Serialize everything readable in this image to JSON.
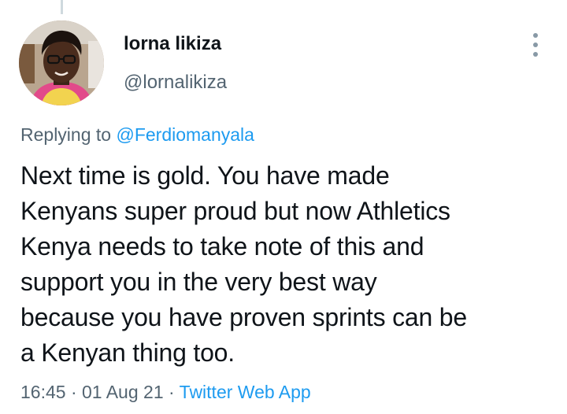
{
  "author": {
    "display_name": "lorna likiza",
    "handle": "@lornalikiza"
  },
  "reply": {
    "prefix": "Replying to",
    "mention": "@Ferdiomanyala"
  },
  "tweet": {
    "text": "Next time is gold. You have made\nKenyans super proud but now Athletics\nKenya needs to take note of this and\nsupport you in the very best way\nbecause you have proven sprints can be\na Kenyan thing too."
  },
  "meta": {
    "time": "16:45",
    "separator": "·",
    "date": "01 Aug 21",
    "source": "Twitter Web App"
  },
  "icons": {
    "more": "more-vertical-icon"
  },
  "colors": {
    "text": "#0f1419",
    "secondary": "#536471",
    "link": "#1d9bf0",
    "thread_line": "#cfd9de"
  }
}
